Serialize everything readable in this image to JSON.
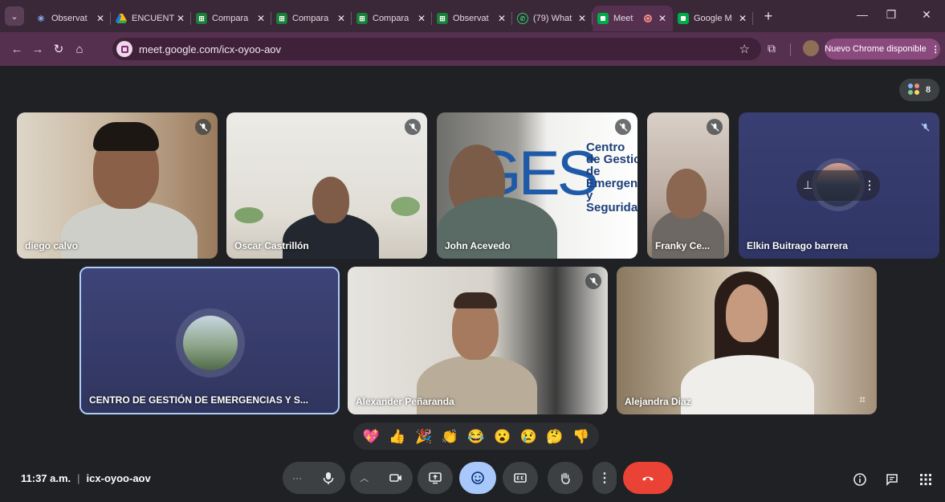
{
  "browser": {
    "tabs": [
      {
        "title": "Observat",
        "favicon": "sparkle-icon",
        "color": "#8ab4f8"
      },
      {
        "title": "ENCUENT",
        "favicon": "drive-icon",
        "color": "#fbbc04"
      },
      {
        "title": "Compara",
        "favicon": "sheets-icon",
        "color": "#34a853"
      },
      {
        "title": "Compara",
        "favicon": "sheets-icon",
        "color": "#34a853"
      },
      {
        "title": "Compara",
        "favicon": "sheets-icon",
        "color": "#34a853"
      },
      {
        "title": "Observat",
        "favicon": "sheets-icon",
        "color": "#34a853"
      },
      {
        "title": "(79) What",
        "favicon": "whatsapp-icon",
        "color": "#25d366"
      },
      {
        "title": "Meet",
        "favicon": "meet-icon",
        "color": "#00ac47",
        "active": true,
        "recording": true
      },
      {
        "title": "Google M",
        "favicon": "meet-icon",
        "color": "#00ac47"
      }
    ],
    "url": "meet.google.com/icx-oyoo-aov",
    "update_button": "Nuevo Chrome disponible"
  },
  "meet": {
    "participant_count": "8",
    "participants": [
      {
        "name": "diego calvo",
        "muted": true
      },
      {
        "name": "Oscar Castrillón",
        "muted": true
      },
      {
        "name": "John Acevedo",
        "muted": true
      },
      {
        "name": "Franky Ce...",
        "muted": true
      },
      {
        "name": "Elkin Buitrago barrera",
        "muted": true
      },
      {
        "name": "CENTRO DE GESTIÓN DE EMERGENCIAS Y S...",
        "muted": false
      },
      {
        "name": "Alexander Peñaranda",
        "muted": true
      },
      {
        "name": "Alejandra Diaz",
        "muted": false
      }
    ],
    "background_sign": {
      "letters": "GES",
      "lines": [
        "Centro",
        "de Gestic",
        "de",
        "Emergenc",
        "y Seguridad"
      ]
    },
    "reactions": [
      "💖",
      "👍",
      "🎉",
      "👏",
      "😂",
      "😮",
      "😢",
      "🤔",
      "👎"
    ],
    "time": "11:37 a.m.",
    "meeting_code": "icx-oyoo-aov"
  }
}
